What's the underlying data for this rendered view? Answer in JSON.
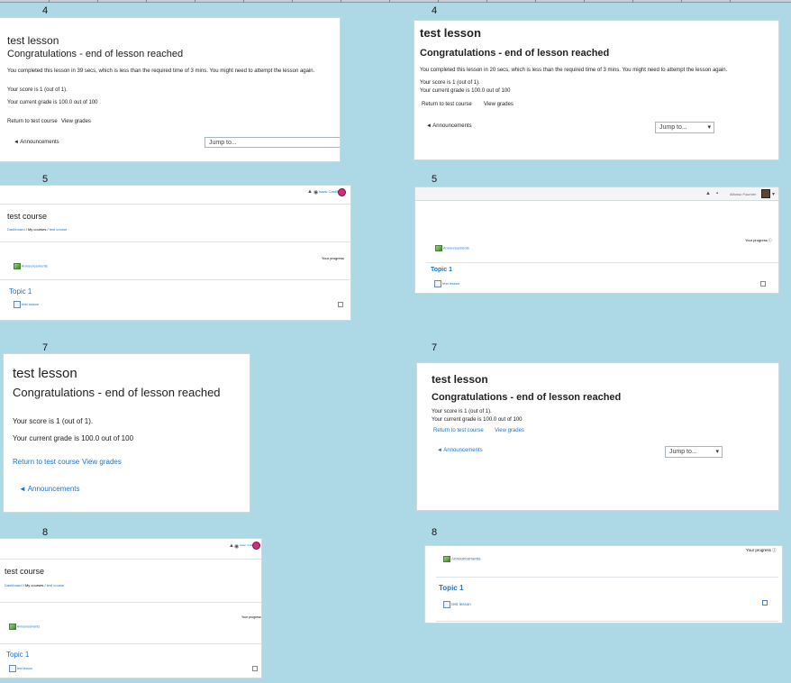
{
  "labels": {
    "l1": "4",
    "r1": "4",
    "l2": "5",
    "r2": "5",
    "l3": "7",
    "r3": "7",
    "l4": "8",
    "r4": "8"
  },
  "lesson": {
    "title": "test lesson",
    "congrats": "Congratulations - end of lesson reached",
    "completed_39": "You completed this lesson in 39 secs, which is less than the required time of 3 mins. You might need to attempt the lesson again.",
    "completed_20": "You completed this lesson in 20 secs, which is less than the required time of 3 mins. You might need to attempt the lesson again.",
    "score": "Your score is 1 (out of 1).",
    "grade": "Your current grade is 100.0 out of 100",
    "return_link": "Return to test course",
    "grades_link": "View grades",
    "prev_link": "◄ Announcements",
    "jump_placeholder": "Jump to..."
  },
  "course": {
    "title": "test course",
    "breadcrumb_dashboard": "Dashboard",
    "breadcrumb_sep": "/",
    "breadcrumb_mycourses": "My courses",
    "breadcrumb_course": "test course",
    "progress": "Your progress",
    "announcements": "Announcements",
    "topic": "Topic 1",
    "lesson_item": "test lesson",
    "user_left": "Isaac Castillo",
    "user_right": "Alfonso Fournier"
  },
  "icons": {
    "bell": "bell-icon",
    "chat": "chat-icon",
    "help": "help-icon",
    "caret": "dropdown-caret-icon",
    "forum": "forum-icon",
    "lesson": "lesson-icon",
    "check": "completion-checkbox-icon"
  },
  "colors": {
    "background": "#add8e6",
    "link": "#1f73c6",
    "panel": "#ffffff"
  }
}
